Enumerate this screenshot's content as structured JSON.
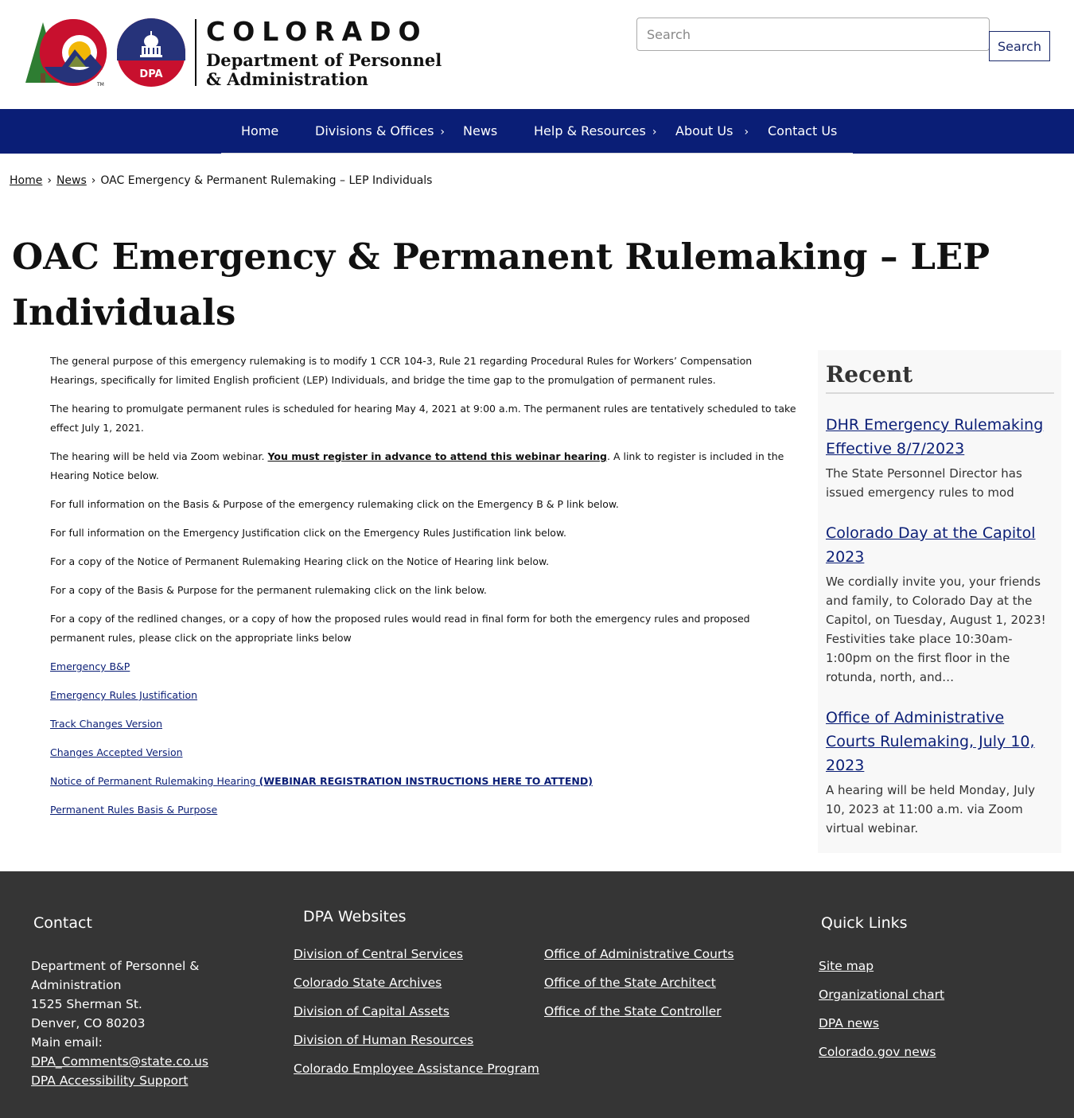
{
  "header": {
    "state_name": "COLORADO",
    "dept_name_line1": "Department of Personnel",
    "dept_name_line2": "& Administration",
    "logo_badge": "DPA",
    "search_placeholder": "Search",
    "search_button": "Search"
  },
  "nav": {
    "items": [
      {
        "label": "Home",
        "has_submenu": false
      },
      {
        "label": "Divisions & Offices",
        "has_submenu": true
      },
      {
        "label": "News",
        "has_submenu": false
      },
      {
        "label": "Help & Resources",
        "has_submenu": true
      },
      {
        "label": "About Us",
        "has_submenu": true
      },
      {
        "label": "Contact Us",
        "has_submenu": false
      }
    ],
    "chevron": "›"
  },
  "breadcrumb": {
    "home": "Home",
    "news": "News",
    "current": "OAC Emergency & Permanent Rulemaking – LEP Individuals",
    "separator": "›"
  },
  "page_title": "OAC Emergency & Permanent Rulemaking – LEP Individuals",
  "main": {
    "p1": "The general purpose of this emergency rulemaking is to modify 1 CCR 104-3, Rule 21 regarding Procedural Rules for Workers’ Compensation Hearings, specifically for limited English proficient (LEP) Individuals, and bridge the time gap to the promulgation of permanent rules.",
    "p2": "The hearing to promulgate permanent rules is scheduled for hearing May 4, 2021 at 9:00 a.m. The permanent rules are tentatively scheduled to take effect July 1, 2021.",
    "p3_before": "The hearing will be held via Zoom webinar.  ",
    "p3_link": "You must register in advance to attend this webinar hearing",
    "p3_after": ". A link to register is included in the Hearing Notice below.",
    "p4": "For full information on the Basis & Purpose of the emergency rulemaking click on the Emergency B & P link below.",
    "p5": "For full information on the Emergency Justification click on the Emergency Rules Justification link below.",
    "p6": "For a copy of the Notice of Permanent Rulemaking Hearing click on the Notice of Hearing link below.",
    "p7": "For a copy of the Basis & Purpose for the permanent rulemaking click on the link below.",
    "p8": "For a copy of the redlined changes, or a copy of how the proposed rules would read in final form for both the emergency rules and proposed permanent rules, please click on the appropriate links below",
    "link_emergency_bp": "Emergency B&P",
    "link_justification": "Emergency Rules Justification",
    "link_track_changes": "Track Changes Version",
    "link_changes_accepted": "Changes Accepted Version",
    "link_notice": "Notice of Permanent Rulemaking Hearing ",
    "link_webinar": " (WEBINAR REGISTRATION INSTRUCTIONS HERE TO ATTEND)",
    "link_permanent_bp": "Permanent Rules Basis & Purpose "
  },
  "sidebar": {
    "title": "Recent",
    "items": [
      {
        "title": "DHR Emergency Rulemaking Effective 8/7/2023",
        "desc": "The State Personnel Director has issued emergency rules to mod"
      },
      {
        "title": "Colorado Day at the Capitol 2023",
        "desc": "We cordially invite you, your friends and family, to Colorado Day at the Capitol, on Tuesday, August 1, 2023!  Festivities take place 10:30am-1:00pm on the first floor in the rotunda, north, and…"
      },
      {
        "title": "Office of Administrative Courts Rulemaking, July 10, 2023",
        "desc": "A hearing will be held Monday, July 10, 2023 at 11:00 a.m. via Zoom virtual webinar."
      }
    ]
  },
  "footer": {
    "contact_title": "Contact",
    "contact_line1": "Department of Personnel & Administration",
    "contact_line2": "1525 Sherman St.",
    "contact_line3": "Denver, CO 80203",
    "contact_line4": "Main email:",
    "contact_email": "DPA_Comments@state.co.us",
    "contact_accessibility": "DPA Accessibility Support",
    "websites_title": "DPA Websites",
    "websites_col1": [
      "Division of Central Services",
      "Colorado State Archives",
      "Division of Capital Assets",
      "Division of Human Resources",
      "Colorado Employee Assistance Program"
    ],
    "websites_col2": [
      "Office of Administrative Courts",
      "Office of the State Architect",
      "Office of the State Controller"
    ],
    "quick_title": "Quick Links",
    "quick_links": [
      "Site map",
      "Organizational chart",
      "DPA news",
      "Colorado.gov news"
    ]
  },
  "colors": {
    "nav_bg": "#0a1e76",
    "link": "#0a1e76",
    "footer_bg": "#353535",
    "logo_red": "#c8102e",
    "logo_blue": "#26337a",
    "logo_green": "#2e7d32",
    "logo_gold": "#f2b705"
  }
}
